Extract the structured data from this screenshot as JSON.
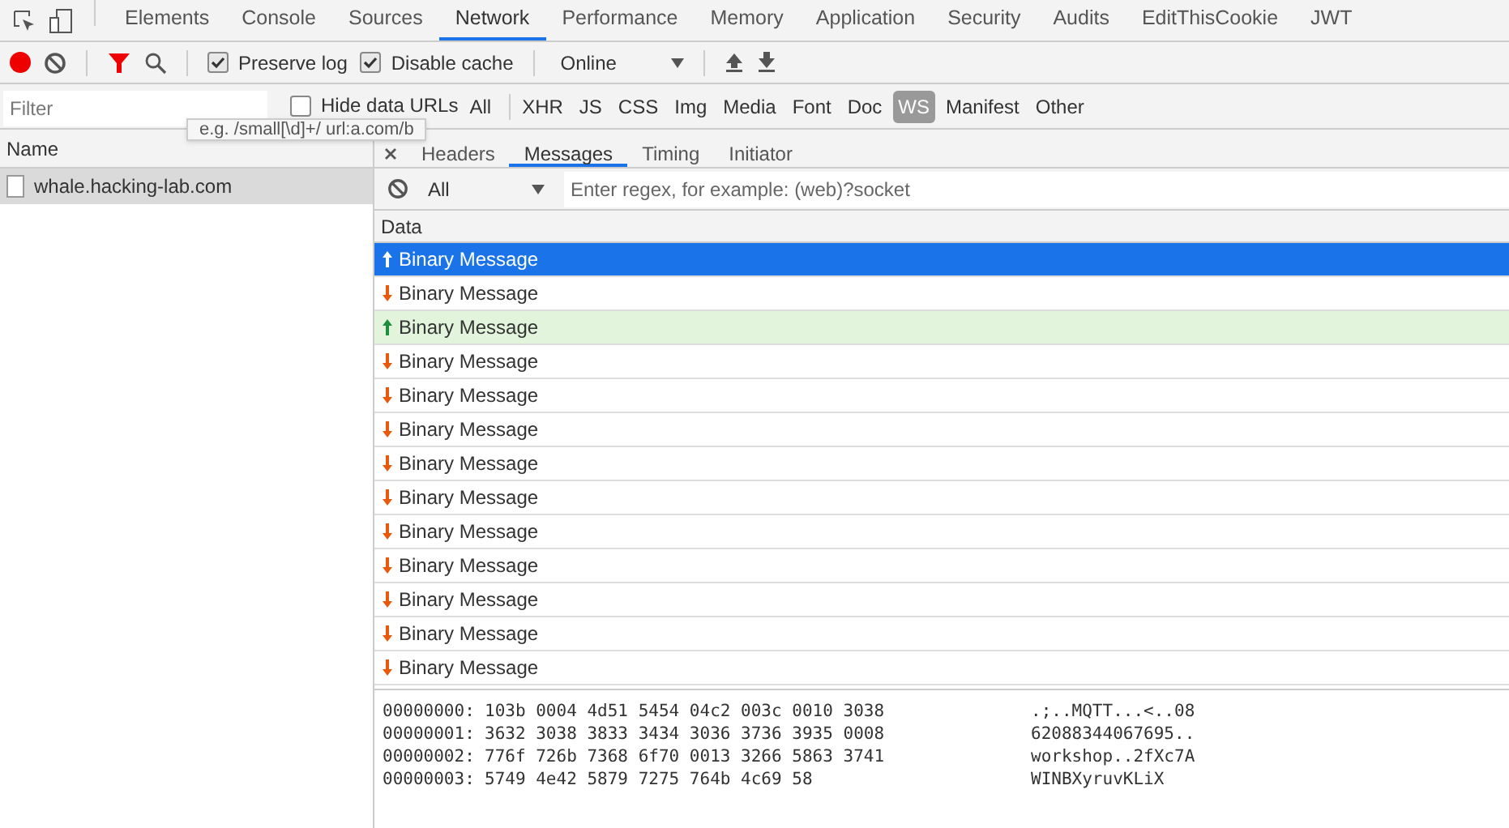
{
  "main_tabs": [
    {
      "label": "Elements",
      "selected": false
    },
    {
      "label": "Console",
      "selected": false
    },
    {
      "label": "Sources",
      "selected": false
    },
    {
      "label": "Network",
      "selected": true
    },
    {
      "label": "Performance",
      "selected": false
    },
    {
      "label": "Memory",
      "selected": false
    },
    {
      "label": "Application",
      "selected": false
    },
    {
      "label": "Security",
      "selected": false
    },
    {
      "label": "Audits",
      "selected": false
    },
    {
      "label": "EditThisCookie",
      "selected": false
    },
    {
      "label": "JWT",
      "selected": false
    }
  ],
  "toolbar": {
    "recording": true,
    "filter_active": true,
    "preserve_log": {
      "label": "Preserve log",
      "checked": true
    },
    "disable_cache": {
      "label": "Disable cache",
      "checked": true
    },
    "throttling": "Online"
  },
  "filter_bar": {
    "placeholder": "Filter",
    "hide_data_urls": {
      "label": "Hide data URLs",
      "checked": false
    },
    "types": [
      {
        "label": "All",
        "selected": false
      },
      {
        "label": "XHR",
        "selected": false
      },
      {
        "label": "JS",
        "selected": false
      },
      {
        "label": "CSS",
        "selected": false
      },
      {
        "label": "Img",
        "selected": false
      },
      {
        "label": "Media",
        "selected": false
      },
      {
        "label": "Font",
        "selected": false
      },
      {
        "label": "Doc",
        "selected": false
      },
      {
        "label": "WS",
        "selected": true
      },
      {
        "label": "Manifest",
        "selected": false
      },
      {
        "label": "Other",
        "selected": false
      }
    ]
  },
  "tooltip": "e.g. /small[\\d]+/ url:a.com/b",
  "requests": {
    "column": "Name",
    "items": [
      {
        "name": "whale.hacking-lab.com",
        "selected": true
      }
    ]
  },
  "detail_tabs": [
    {
      "label": "Headers",
      "selected": false
    },
    {
      "label": "Messages",
      "selected": true
    },
    {
      "label": "Timing",
      "selected": false
    },
    {
      "label": "Initiator",
      "selected": false
    }
  ],
  "message_filter": {
    "type": "All",
    "placeholder": "Enter regex, for example: (web)?socket"
  },
  "messages": {
    "column": "Data",
    "rows": [
      {
        "text": "Binary Message",
        "kind": "sent",
        "selected": true
      },
      {
        "text": "Binary Message",
        "kind": "received",
        "selected": false
      },
      {
        "text": "Binary Message",
        "kind": "sent",
        "selected": false
      },
      {
        "text": "Binary Message",
        "kind": "received",
        "selected": false
      },
      {
        "text": "Binary Message",
        "kind": "received",
        "selected": false
      },
      {
        "text": "Binary Message",
        "kind": "received",
        "selected": false
      },
      {
        "text": "Binary Message",
        "kind": "received",
        "selected": false
      },
      {
        "text": "Binary Message",
        "kind": "received",
        "selected": false
      },
      {
        "text": "Binary Message",
        "kind": "received",
        "selected": false
      },
      {
        "text": "Binary Message",
        "kind": "received",
        "selected": false
      },
      {
        "text": "Binary Message",
        "kind": "received",
        "selected": false
      },
      {
        "text": "Binary Message",
        "kind": "received",
        "selected": false
      },
      {
        "text": "Binary Message",
        "kind": "received",
        "selected": false
      }
    ]
  },
  "hex_dump": [
    {
      "offset": "00000000:",
      "hex": "103b 0004 4d51 5454 04c2 003c 0010 3038",
      "ascii": ".;..MQTT...<..08"
    },
    {
      "offset": "00000001:",
      "hex": "3632 3038 3833 3434 3036 3736 3935 0008",
      "ascii": "62088344067695.."
    },
    {
      "offset": "00000002:",
      "hex": "776f 726b 7368 6f70 0013 3266 5863 3741",
      "ascii": "workshop..2fXc7A"
    },
    {
      "offset": "00000003:",
      "hex": "5749 4e42 5879 7275 764b 4c69 58",
      "ascii": "WINBXyruvKLiX"
    }
  ]
}
